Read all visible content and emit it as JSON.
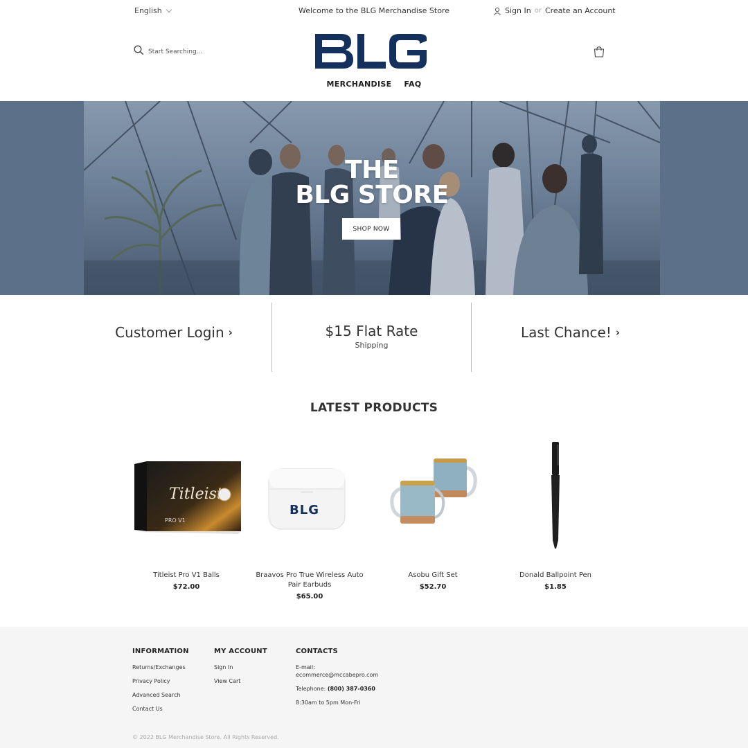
{
  "topbar": {
    "language": "English",
    "welcome": "Welcome to the BLG Merchandise Store",
    "sign_in": "Sign In",
    "or": "or",
    "create_account": "Create an Account"
  },
  "header": {
    "search_placeholder": "Start Searching...",
    "logo_text": "BLG",
    "brand_color": "#14305c",
    "nav": [
      "MERCHANDISE",
      "FAQ"
    ]
  },
  "hero": {
    "title_line1": "THE",
    "title_line2": "BLG STORE",
    "button": "SHOP NOW"
  },
  "promo": {
    "customer_login": "Customer Login",
    "flat_rate": "$15 Flat Rate",
    "shipping": "Shipping",
    "last_chance": "Last Chance!"
  },
  "latest": {
    "title": "LATEST PRODUCTS",
    "products": [
      {
        "name": "Titleist Pro V1 Balls",
        "price": "$72.00",
        "image": "golf-ball-box"
      },
      {
        "name": "Braavos Pro True Wireless Auto Pair Earbuds",
        "price": "$65.00",
        "image": "earbuds-case"
      },
      {
        "name": "Asobu Gift Set",
        "price": "$52.70",
        "image": "mugs"
      },
      {
        "name": "Donald Ballpoint Pen",
        "price": "$1.85",
        "image": "pen"
      }
    ],
    "box_brand": "Titleist",
    "box_model": "PRO V1",
    "case_logo": "BLG"
  },
  "footer": {
    "information": {
      "title": "INFORMATION",
      "links": [
        "Returns/Exchanges",
        "Privacy Policy",
        "Advanced Search",
        "Contact Us"
      ]
    },
    "my_account": {
      "title": "MY ACCOUNT",
      "links": [
        "Sign In",
        "View Cart"
      ]
    },
    "contacts": {
      "title": "CONTACTS",
      "email_label": "E-mail:",
      "email": "ecommerce@mccabepro.com",
      "telephone_label": "Telephone:",
      "telephone": "(800) 387-0360",
      "hours": "8:30am to 5pm Mon-Fri"
    },
    "copyright": "© 2022 BLG Merchandise Store. All Rights Reserved."
  }
}
